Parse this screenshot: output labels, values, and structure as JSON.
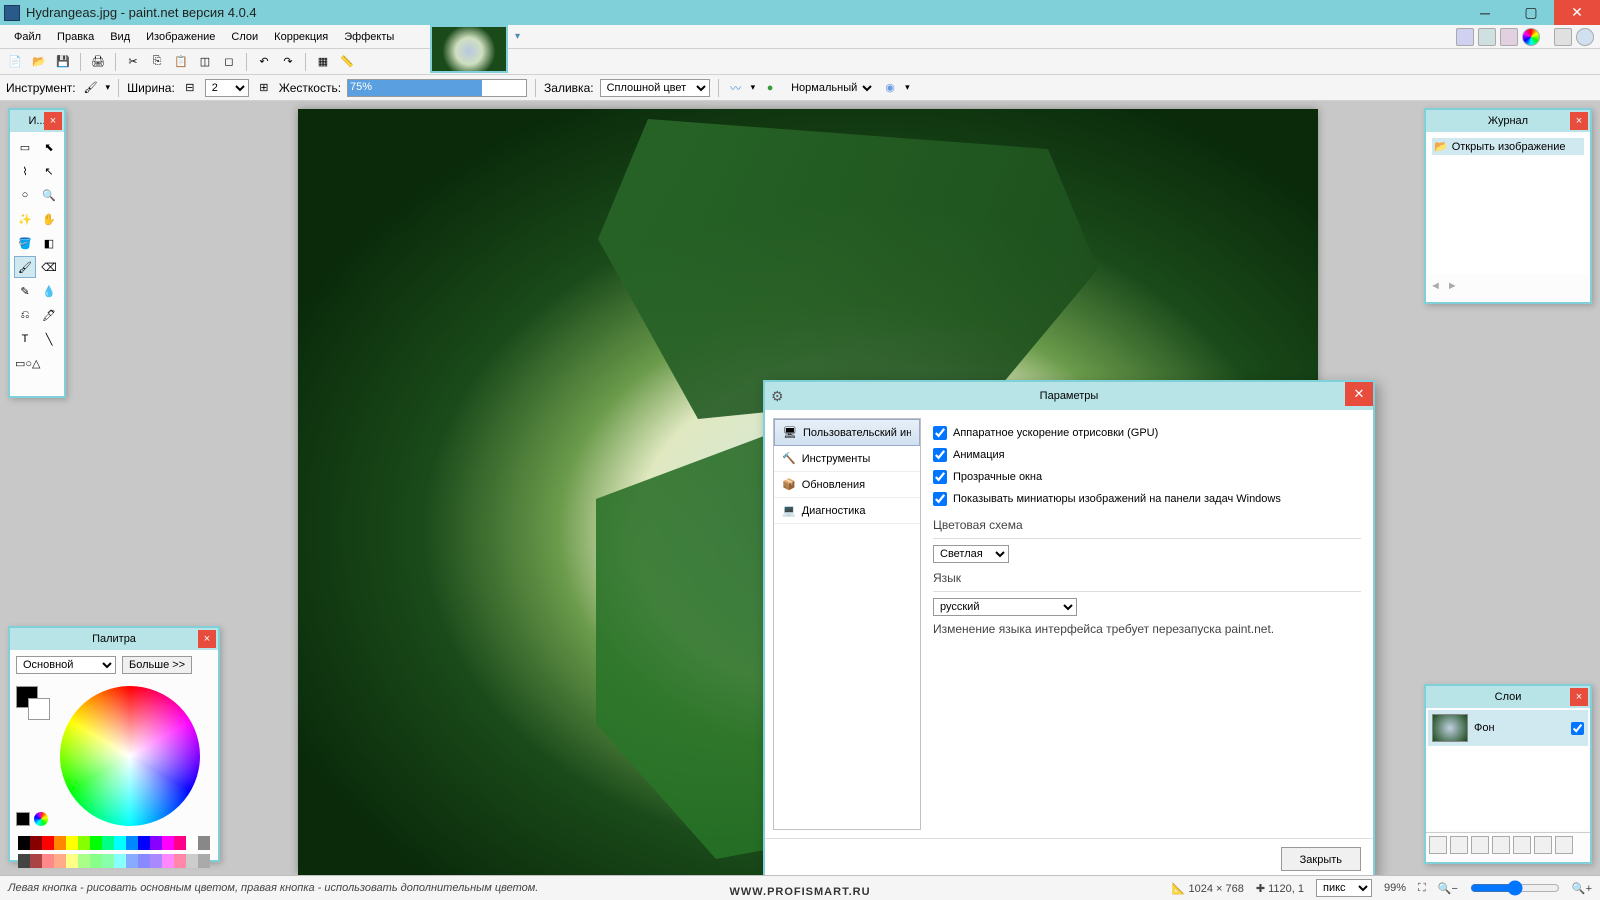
{
  "title": "Hydrangeas.jpg - paint.net версия 4.0.4",
  "menu": {
    "file": "Файл",
    "edit": "Правка",
    "view": "Вид",
    "image": "Изображение",
    "layers": "Слои",
    "adjust": "Коррекция",
    "effects": "Эффекты"
  },
  "toolbar2": {
    "tool_label": "Инструмент:",
    "width_label": "Ширина:",
    "width_val": "2",
    "hardness_label": "Жесткость:",
    "hardness_val": "75%",
    "fill_label": "Заливка:",
    "fill_val": "Сплошной цвет",
    "blend_val": "Нормальный"
  },
  "tools_title": "И...",
  "history": {
    "title": "Журнал",
    "item": "Открыть изображение"
  },
  "layers": {
    "title": "Слои",
    "item": "Фон"
  },
  "palette": {
    "title": "Палитра",
    "primary": "Основной",
    "more": "Больше >>"
  },
  "dialog": {
    "title": "Параметры",
    "nav": {
      "ui": "Пользовательский ин",
      "tools": "Инструменты",
      "updates": "Обновления",
      "diag": "Диагностика"
    },
    "chk": {
      "gpu": "Аппаратное ускорение отрисовки (GPU)",
      "anim": "Анимация",
      "trans": "Прозрачные окна",
      "thumb": "Показывать миниатюры изображений на панели задач Windows"
    },
    "color_scheme_label": "Цветовая схема",
    "color_scheme_val": "Светлая",
    "lang_label": "Язык",
    "lang_val": "русский",
    "lang_note": "Изменение языка интерфейса требует перезапуска paint.net.",
    "close": "Закрыть"
  },
  "status": {
    "hint": "Левая кнопка - рисовать основным цветом, правая кнопка - использовать дополнительным цветом.",
    "dims": "1024 × 768",
    "pos": "1120, 1",
    "units": "пикс",
    "zoom": "99%"
  },
  "watermark": "WWW.PROFISMART.RU"
}
